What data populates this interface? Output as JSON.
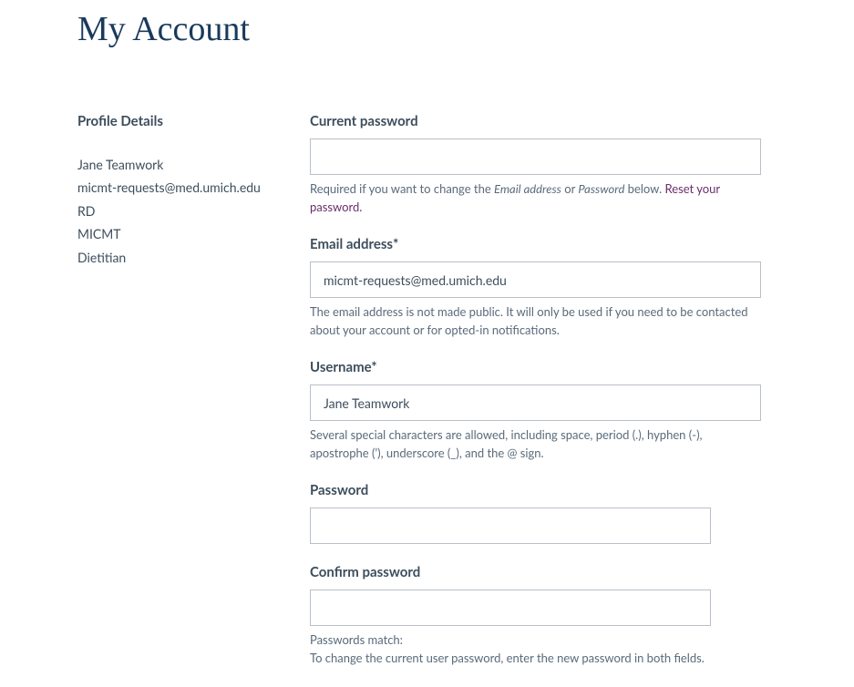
{
  "pageTitle": "My Account",
  "sidebar": {
    "heading": "Profile Details",
    "items": [
      "Jane Teamwork",
      "micmt-requests@med.umich.edu",
      "RD",
      "MICMT",
      "Dietitian"
    ]
  },
  "form": {
    "currentPassword": {
      "label": "Current password",
      "value": "",
      "helpPrefix": "Required if you want to change the ",
      "helpEm1": "Email address",
      "helpMid": " or ",
      "helpEm2": "Password",
      "helpSuffix": " below. ",
      "resetLink": "Reset your password."
    },
    "email": {
      "label": "Email address*",
      "value": "micmt-requests@med.umich.edu",
      "help": "The email address is not made public. It will only be used if you need to be contacted about your account or for opted-in notifications."
    },
    "username": {
      "label": "Username*",
      "value": "Jane Teamwork",
      "help": "Several special characters are allowed, including space, period (.), hyphen (-), apostrophe ('), underscore (_), and the @ sign."
    },
    "password": {
      "label": "Password",
      "value": ""
    },
    "confirmPassword": {
      "label": "Confirm password",
      "value": "",
      "helpLine1": "Passwords match:",
      "helpLine2": "To change the current user password, enter the new password in both fields."
    }
  }
}
